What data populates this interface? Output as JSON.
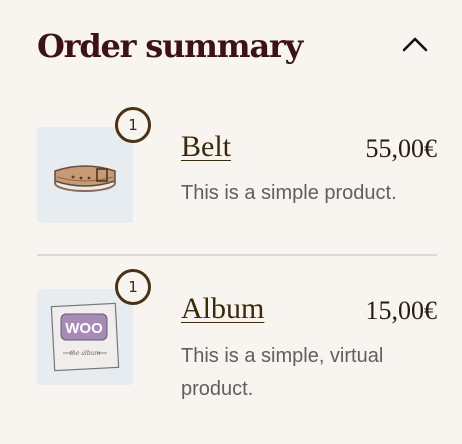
{
  "summary": {
    "title": "Order summary",
    "toggle_icon": "chevron-up-icon"
  },
  "items": [
    {
      "name": "Belt",
      "price": "55,00€",
      "quantity": "1",
      "description": "This is a simple product.",
      "image_icon": "belt-product-image"
    },
    {
      "name": "Album",
      "price": "15,00€",
      "quantity": "1",
      "description": "This is a simple, virtual product.",
      "image_icon": "album-product-image",
      "image_text": "WOO",
      "image_subtext": "the album"
    }
  ],
  "colors": {
    "background": "#f8f4ef",
    "title": "#3d1216",
    "badge_border": "#4a3212",
    "thumb_bg": "#e6ecef",
    "divider": "#d9dadb"
  }
}
